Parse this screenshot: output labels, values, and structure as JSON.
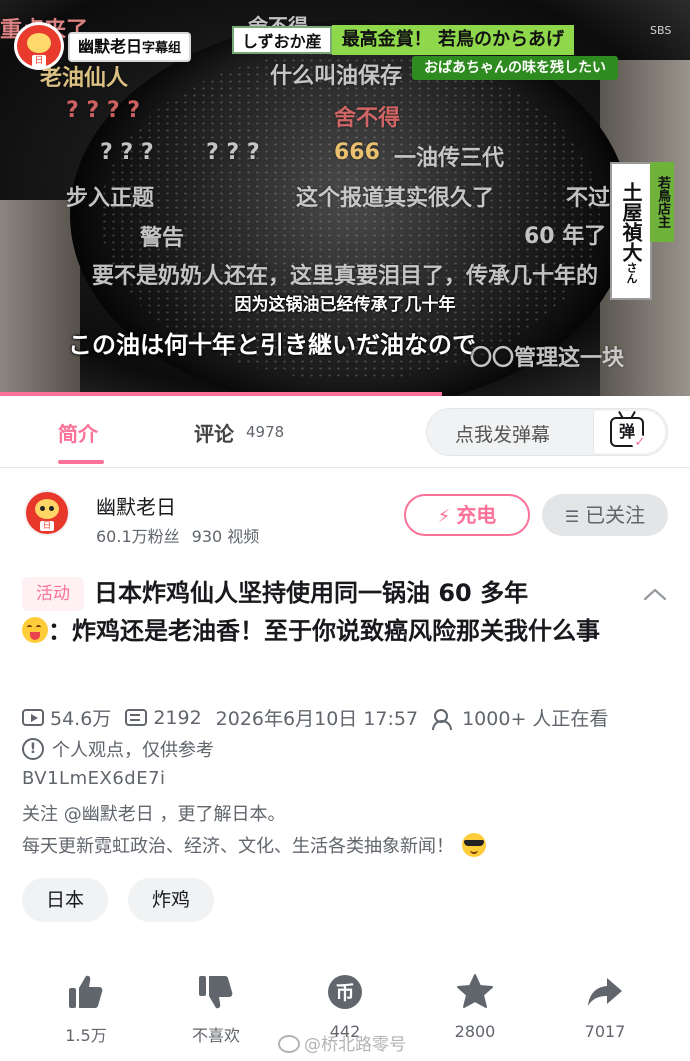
{
  "video": {
    "channel_logo_text": "幽默老日",
    "channel_logo_suffix": "字幕组",
    "logo_daruma_mark": "日",
    "ticker_origin": "しずおか産",
    "ticker_headline": "最高金賞！ 若鳥のからあげ",
    "broadcaster": "SBS",
    "ticker_subtitle": "おばあちゃんの味を残したい",
    "name_plate": "土屋禎大",
    "name_plate_suffix": "さん",
    "role_plate": "若鳥店主",
    "caption_zh": "因为这锅油已经传承了几十年",
    "caption_jp": "この油は何十年と引き継いだ油なので",
    "progress_fraction": 0.64,
    "danmaku": [
      "重点来了",
      "舍不得",
      "老油仙人",
      "666",
      "一油传三代",
      "步入正题",
      "这个报道其实很久了",
      "不过挺好",
      "警告",
      "60 年了",
      "要不是奶奶人还在，这里真要泪目了，传承几十年的",
      "〇〇管理这一块",
      "? ? ? ?",
      "? ? ?",
      "? ?",
      "什么叫油保存"
    ]
  },
  "tabs": {
    "intro_label": "简介",
    "comments_label": "评论",
    "comments_count": "4978",
    "danmaku_placeholder": "点我发弹幕",
    "danmaku_button_glyph": "弹"
  },
  "uploader": {
    "avatar_mark": "日",
    "name": "幽默老日",
    "fans": "60.1万粉丝",
    "videos": "930 视频",
    "charge_label": "充电",
    "follow_label": "已关注"
  },
  "video_info": {
    "activity_tag": "活动",
    "title_part1": "日本炸鸡仙人坚持使用同一锅油 60 多年",
    "title_part2": "：炸鸡还是老油香！至于你说致癌风险那关我什么事",
    "views": "54.6万",
    "danmaku_count": "2192",
    "date": "2026年6月10日 17:57",
    "watching": "1000+ 人正在看",
    "notice": "个人观点，仅供参考",
    "bvid": "BV1LmEX6dE7i",
    "desc_line1": "关注 @幽默老日 ，更了解日本。",
    "desc_line2": "每天更新霓虹政治、经济、文化、生活各类抽象新闻！"
  },
  "tags": [
    "日本",
    "炸鸡"
  ],
  "actions": {
    "like": "1.5万",
    "dislike": "不喜欢",
    "coin": "442",
    "favorite": "2800",
    "share": "7017"
  },
  "watermark": "@桥北路零号",
  "colors": {
    "accent_pink": "#fb7299",
    "ticker_green": "#8fd84b",
    "text_primary": "#18191c",
    "text_secondary": "#61666d"
  }
}
